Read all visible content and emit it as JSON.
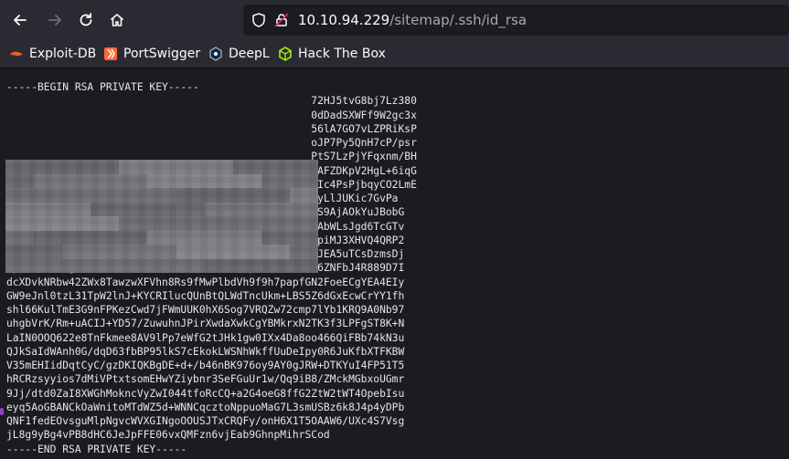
{
  "nav": {
    "back_icon": "arrow-left-icon",
    "forward_icon": "arrow-right-icon",
    "reload_icon": "reload-icon",
    "home_icon": "home-icon"
  },
  "urlbar": {
    "host": "10.10.94.229",
    "path": "/sitemap/.ssh/id_rsa"
  },
  "bookmarks": [
    {
      "label": "Exploit-DB",
      "icon": "exploitdb-icon",
      "color": "#e8632c"
    },
    {
      "label": "PortSwigger",
      "icon": "portswigger-icon",
      "color": "#ff6633"
    },
    {
      "label": "DeepL",
      "icon": "deepl-icon",
      "color": "#0f2b46"
    },
    {
      "label": "Hack The Box",
      "icon": "htb-cube-icon",
      "color": "#9fef00"
    }
  ],
  "key_lines": [
    "-----BEGIN RSA PRIVATE KEY-----",
    "                                                 72HJ5tvG8bj7Lz380",
    "                                                 0dDadSXWFf9W2gc3x",
    "                                                 56lA7GO7vLZPRiKsP",
    "                                                 oJP7Py5QnH7cP/psr",
    "                                                 PtS7LzPjYFqxnm/BH",
    "                                                 BAFZDKpV2HgL+6iqG",
    "                                                 2Ic4PsPjbqyCO2LmE",
    "AHAHKQNeBUmSymGJL09TJMJ1gbJxZdwX0rB00Jcs9QJMBDZthWyLlJUKic7GvPa",
    "M7QYKP51VCi1j3GrOd1ygFSRkP6jZpOpM33dG1/ubom7OWDZPDS9AjAOkYuJBobG",
    "SUM+uxh7JJn8uM9J4NvQPkC10RIXFYECwNW+iHsB0CWlcF7CAZAbWLsJgd6TcGTv",
    "2KBA6YcfGXN0b49CFOBMLBY/dcWyHu+d0KcruHTeTnM7aLdrexpiMJ3XHVQ4QRP2",
    "p3xz9QECgYEA+VXndZU98FT+armRv8iwuCOAmN8p7tD1W9S2evJEA5uTCsDzmsDj",
    "7pUO8zziTXgeDENrcz1uo0e3bL13MiZeFe9HQNMpVOX+vEaCZd6ZNFbJ4R889D7I",
    "dcXDvkNRbw42ZWx8TawzwXFVhn8Rs9fMwPlbdVh9f9h7papfGN2FoeECgYEA4EIy",
    "GW9eJnl0tzL31TpW2lnJ+KYCRIlucQUnBtQLWdTncUkm+LBS5Z6dGxEcwCrYY1fh",
    "shl66KulTmE3G9nFPKezCwd7jFWmUUK0hX6Sog7VRQZw72cmp7lYb1KRQ9A0Nb97",
    "uhgbVrK/Rm+uACIJ+YD57/ZuwuhnJPirXwdaXwkCgYBMkrxN2TK3f3LPFgST8K+N",
    "LaIN0OOQ622e8TnFkmee8AV9lPp7eWfG2tJHk1gw0IXx4Da8oo466QiFBb74kN3u",
    "QJkSaIdWAnh0G/dqD63fbBP95lkS7cEkokLWSNhWkffUuDeIpy0R6JuKfbXTFKBW",
    "V35mEHIidDqtCyC/gzDKIQKBgDE+d+/b46nBK976oy9AY0gJRW+DTKYuI4FP51T5",
    "hRCRzsyyios7dMiVPtxtsomEHwYZiybnr3SeFGuUr1w/Qq9iB8/ZMckMGbxoUGmr",
    "9Jj/dtd0ZaI8XWGhMokncVyZwI044tfoRcCQ+a2G4oeG8ffG2ZtW2tWT4OpebIsu",
    "eyq5AoGBANCkOaWnitoMTdWZ5d+WNNCqcztoNppuoMaG7L3smUSBz6k8J4p4yDPb",
    "QNF1fedEOvsguMlpNgvcWVXGINgoOOUSJTxCRQFy/onH6X1T5OAAW6/UXc4S7Vsg",
    "jL8g9yBg4vPB8dHC6JeJpFFE06vxQMFzn6vjEab9GhnpMihrSCod",
    "-----END RSA PRIVATE KEY-----"
  ]
}
